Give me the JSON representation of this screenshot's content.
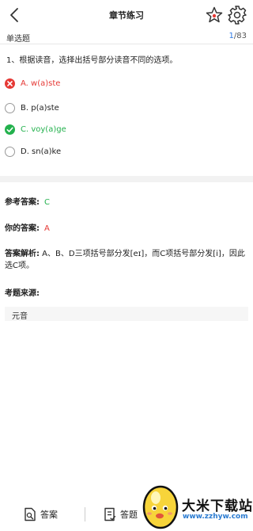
{
  "header": {
    "title": "章节练习",
    "back_icon": "back-chevron-icon",
    "favorite_icon": "star-icon",
    "settings_icon": "gear-icon"
  },
  "question_bar": {
    "type_label": "单选题",
    "current": "1",
    "total": "/83"
  },
  "question": {
    "text": "1、根据读音，选择出括号部分读音不同的选项。"
  },
  "options": [
    {
      "label": "A. w(a)ste",
      "state": "wrong"
    },
    {
      "label": "B. p(a)ste",
      "state": "none"
    },
    {
      "label": "C. voy(a)ge",
      "state": "correct"
    },
    {
      "label": "D. sn(a)ke",
      "state": "none"
    }
  ],
  "result": {
    "reference_label": "参考答案:",
    "reference_value": "C",
    "your_label": "你的答案:",
    "your_value": "A",
    "analysis_label": "答案解析:",
    "analysis_text": " A、B、D三项括号部分发[eɪ]，而C项括号部分发[i]，因此选C项。",
    "source_label": "考题来源:",
    "source_value": "元音"
  },
  "bottom_bar": {
    "answer_label": "答案",
    "answer_icon": "answer-sheet-icon",
    "sheet_label": "答题",
    "sheet_icon": "answer-card-icon"
  },
  "watermark": {
    "brand": "大米下载站",
    "url": "www.zzhyw.com"
  },
  "colors": {
    "accent_blue": "#2f7be5",
    "wrong_red": "#e53935",
    "correct_green": "#23b14d"
  }
}
